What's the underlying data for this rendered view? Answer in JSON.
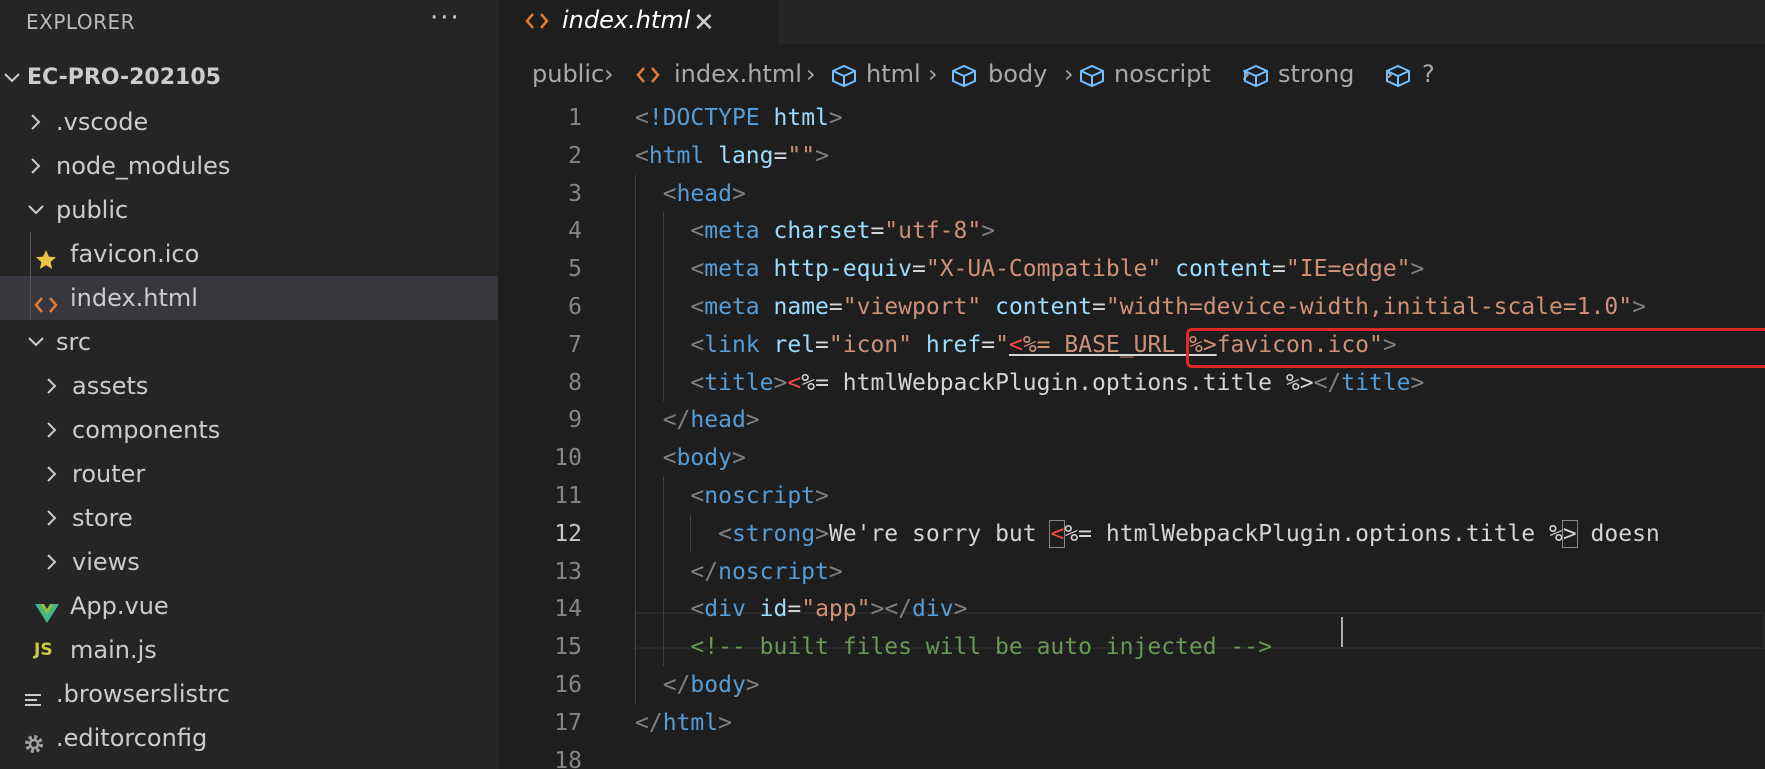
{
  "sidebar": {
    "title": "EXPLORER",
    "more_label": "···",
    "root": "EC-PRO-202105",
    "items": [
      {
        "label": ".vscode",
        "kind": "folder",
        "expanded": false
      },
      {
        "label": "node_modules",
        "kind": "folder",
        "expanded": false
      },
      {
        "label": "public",
        "kind": "folder",
        "expanded": true
      },
      {
        "label": "favicon.ico",
        "kind": "file",
        "icon": "star-icon"
      },
      {
        "label": "index.html",
        "kind": "file",
        "icon": "html-icon",
        "selected": true
      },
      {
        "label": "src",
        "kind": "folder",
        "expanded": true
      },
      {
        "label": "assets",
        "kind": "folder",
        "expanded": false
      },
      {
        "label": "components",
        "kind": "folder",
        "expanded": false
      },
      {
        "label": "router",
        "kind": "folder",
        "expanded": false
      },
      {
        "label": "store",
        "kind": "folder",
        "expanded": false
      },
      {
        "label": "views",
        "kind": "folder",
        "expanded": false
      },
      {
        "label": "App.vue",
        "kind": "file",
        "icon": "vue-icon"
      },
      {
        "label": "main.js",
        "kind": "file",
        "icon": "js-icon",
        "icon_text": "JS"
      },
      {
        "label": ".browserslistrc",
        "kind": "file",
        "icon": "lines-icon"
      },
      {
        "label": ".editorconfig",
        "kind": "file",
        "icon": "gear-icon"
      }
    ]
  },
  "editor": {
    "tab": {
      "label": "index.html",
      "close": "✕"
    },
    "breadcrumb": [
      "public",
      "index.html",
      "html",
      "body",
      "noscript",
      "strong",
      "?"
    ],
    "current_line": 12,
    "lines": [
      {
        "n": "1",
        "tokens": [
          [
            "t-punct",
            "<"
          ],
          [
            "t-tag",
            "!DOCTYPE"
          ],
          [
            "t-text",
            " "
          ],
          [
            "t-attr",
            "html"
          ],
          [
            "t-punct",
            ">"
          ]
        ]
      },
      {
        "n": "2",
        "tokens": [
          [
            "t-punct",
            "<"
          ],
          [
            "t-tag",
            "html"
          ],
          [
            "t-text",
            " "
          ],
          [
            "t-attr",
            "lang"
          ],
          [
            "t-text",
            "="
          ],
          [
            "t-str",
            "\"\""
          ],
          [
            "t-punct",
            ">"
          ]
        ]
      },
      {
        "n": "3",
        "tokens": [
          [
            "t-text",
            "  "
          ],
          [
            "t-punct",
            "<"
          ],
          [
            "t-tag",
            "head"
          ],
          [
            "t-punct",
            ">"
          ]
        ]
      },
      {
        "n": "4",
        "tokens": [
          [
            "t-text",
            "    "
          ],
          [
            "t-punct",
            "<"
          ],
          [
            "t-tag",
            "meta"
          ],
          [
            "t-text",
            " "
          ],
          [
            "t-attr",
            "charset"
          ],
          [
            "t-text",
            "="
          ],
          [
            "t-str",
            "\"utf-8\""
          ],
          [
            "t-punct",
            ">"
          ]
        ]
      },
      {
        "n": "5",
        "tokens": [
          [
            "t-text",
            "    "
          ],
          [
            "t-punct",
            "<"
          ],
          [
            "t-tag",
            "meta"
          ],
          [
            "t-text",
            " "
          ],
          [
            "t-attr",
            "http-equiv"
          ],
          [
            "t-text",
            "="
          ],
          [
            "t-str",
            "\"X-UA-Compatible\""
          ],
          [
            "t-text",
            " "
          ],
          [
            "t-attr",
            "content"
          ],
          [
            "t-text",
            "="
          ],
          [
            "t-str",
            "\"IE=edge\""
          ],
          [
            "t-punct",
            ">"
          ]
        ]
      },
      {
        "n": "6",
        "tokens": [
          [
            "t-text",
            "    "
          ],
          [
            "t-punct",
            "<"
          ],
          [
            "t-tag",
            "meta"
          ],
          [
            "t-text",
            " "
          ],
          [
            "t-attr",
            "name"
          ],
          [
            "t-text",
            "="
          ],
          [
            "t-str",
            "\"viewport\""
          ],
          [
            "t-text",
            " "
          ],
          [
            "t-attr",
            "content"
          ],
          [
            "t-text",
            "="
          ],
          [
            "t-str",
            "\"width=device-width,initial-scale=1.0\""
          ],
          [
            "t-punct",
            ">"
          ]
        ]
      },
      {
        "n": "7",
        "tokens": [
          [
            "t-text",
            "    "
          ],
          [
            "t-punct",
            "<"
          ],
          [
            "t-tag",
            "link"
          ],
          [
            "t-text",
            " "
          ],
          [
            "t-attr",
            "rel"
          ],
          [
            "t-text",
            "="
          ],
          [
            "t-str",
            "\"icon\""
          ],
          [
            "t-text",
            " "
          ],
          [
            "t-attr",
            "href"
          ],
          [
            "t-text",
            "="
          ],
          [
            "t-str",
            "\""
          ],
          [
            "t-err underline",
            "<"
          ],
          [
            "t-str underline",
            "%= BASE_URL %>"
          ],
          [
            "t-str",
            "favicon.ico\""
          ],
          [
            "t-punct",
            ">"
          ]
        ]
      },
      {
        "n": "8",
        "tokens": [
          [
            "t-text",
            "    "
          ],
          [
            "t-punct",
            "<"
          ],
          [
            "t-tag",
            "title"
          ],
          [
            "t-punct",
            ">"
          ],
          [
            "t-err",
            "<"
          ],
          [
            "t-text",
            "%= htmlWebpackPlugin.options.title %>"
          ],
          [
            "t-punct",
            "</"
          ],
          [
            "t-tag",
            "title"
          ],
          [
            "t-punct",
            ">"
          ]
        ]
      },
      {
        "n": "9",
        "tokens": [
          [
            "t-text",
            "  "
          ],
          [
            "t-punct",
            "</"
          ],
          [
            "t-tag",
            "head"
          ],
          [
            "t-punct",
            ">"
          ]
        ]
      },
      {
        "n": "10",
        "tokens": [
          [
            "t-text",
            "  "
          ],
          [
            "t-punct",
            "<"
          ],
          [
            "t-tag",
            "body"
          ],
          [
            "t-punct",
            ">"
          ]
        ]
      },
      {
        "n": "11",
        "tokens": [
          [
            "t-text",
            "    "
          ],
          [
            "t-punct",
            "<"
          ],
          [
            "t-tag",
            "noscript"
          ],
          [
            "t-punct",
            ">"
          ]
        ]
      },
      {
        "n": "12",
        "tokens": [
          [
            "t-text",
            "      "
          ],
          [
            "t-punct",
            "<"
          ],
          [
            "t-tag",
            "strong"
          ],
          [
            "t-punct",
            ">"
          ],
          [
            "t-text",
            "We're sorry but "
          ],
          [
            "t-err bracket-box",
            "<"
          ],
          [
            "t-text",
            "%= htmlWebpackPlugin.options.title %"
          ],
          [
            "t-text bracket-box",
            ">"
          ],
          [
            "t-text",
            " doesn"
          ]
        ]
      },
      {
        "n": "13",
        "tokens": [
          [
            "t-text",
            "    "
          ],
          [
            "t-punct",
            "</"
          ],
          [
            "t-tag",
            "noscript"
          ],
          [
            "t-punct",
            ">"
          ]
        ]
      },
      {
        "n": "14",
        "tokens": [
          [
            "t-text",
            "    "
          ],
          [
            "t-punct",
            "<"
          ],
          [
            "t-tag",
            "div"
          ],
          [
            "t-text",
            " "
          ],
          [
            "t-attr",
            "id"
          ],
          [
            "t-text",
            "="
          ],
          [
            "t-str",
            "\"app\""
          ],
          [
            "t-punct",
            "></"
          ],
          [
            "t-tag",
            "div"
          ],
          [
            "t-punct",
            ">"
          ]
        ]
      },
      {
        "n": "15",
        "tokens": [
          [
            "t-text",
            "    "
          ],
          [
            "t-comment",
            "<!-- built files will be auto injected -->"
          ]
        ]
      },
      {
        "n": "16",
        "tokens": [
          [
            "t-text",
            "  "
          ],
          [
            "t-punct",
            "</"
          ],
          [
            "t-tag",
            "body"
          ],
          [
            "t-punct",
            ">"
          ]
        ]
      },
      {
        "n": "17",
        "tokens": [
          [
            "t-punct",
            "</"
          ],
          [
            "t-tag",
            "html"
          ],
          [
            "t-punct",
            ">"
          ]
        ]
      },
      {
        "n": "18",
        "tokens": []
      }
    ]
  }
}
